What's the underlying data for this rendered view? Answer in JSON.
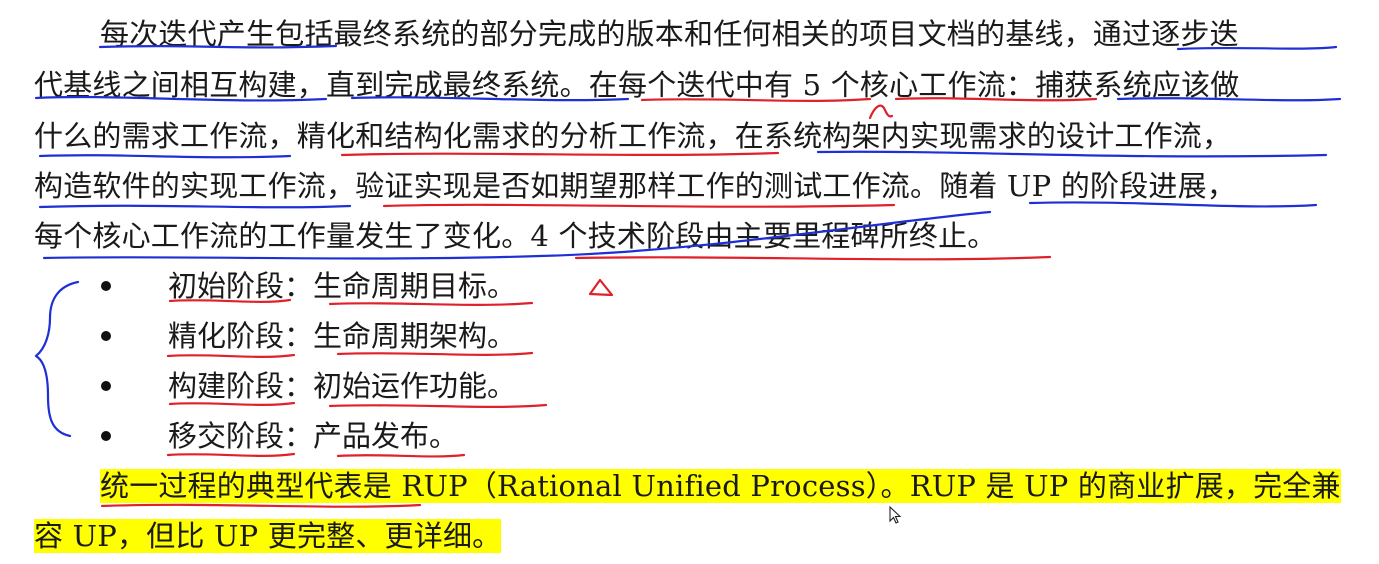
{
  "paragraph1": {
    "line1": "每次迭代产生包括最终系统的部分完成的版本和任何相关的项目文档的基线，通过逐步迭",
    "line2": "代基线之间相互构建，直到完成最终系统。在每个迭代中有 5 个核心工作流：捕获系统应该做",
    "line3": "什么的需求工作流，精化和结构化需求的分析工作流，在系统构架内实现需求的设计工作流，",
    "line4": "构造软件的实现工作流，验证实现是否如期望那样工作的测试工作流。随着 UP 的阶段进展，",
    "line5": "每个核心工作流的工作量发生了变化。4 个技术阶段由主要里程碑所终止。"
  },
  "phases": [
    {
      "name": "初始阶段",
      "sep": "：",
      "milestone": "生命周期目标。"
    },
    {
      "name": "精化阶段",
      "sep": "：",
      "milestone": "生命周期架构。"
    },
    {
      "name": "构建阶段",
      "sep": "：",
      "milestone": "初始运作功能。"
    },
    {
      "name": "移交阶段",
      "sep": "：",
      "milestone": "产品发布。"
    }
  ],
  "paragraph2": {
    "line1": "统一过程的典型代表是 RUP（Rational Unified Process）。RUP 是 UP 的商业扩展，完全兼",
    "line2": "容 UP，但比 UP 更完整、更详细。"
  },
  "colors": {
    "highlight": "#ffff00",
    "blue_ink": "#1f2fd6",
    "red_ink": "#e0202a"
  }
}
